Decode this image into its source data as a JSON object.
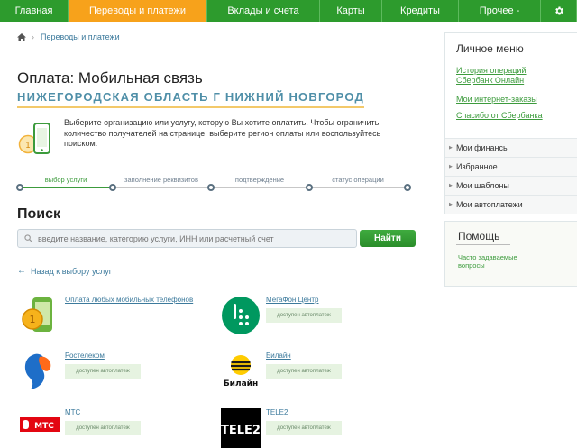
{
  "nav": {
    "items": [
      {
        "label": "Главная",
        "width": 76
      },
      {
        "label": "Переводы и платежи",
        "width": 154,
        "active": true
      },
      {
        "label": "Вклады и счета",
        "width": 125
      },
      {
        "label": "Карты",
        "width": 69
      },
      {
        "label": "Кредиты",
        "width": 85
      },
      {
        "label": "Прочее -",
        "width": 91
      }
    ],
    "settings_icon": "gear-icon"
  },
  "breadcrumb": {
    "home_icon": "home-icon",
    "current": "Переводы и платежи"
  },
  "page": {
    "title": "Оплата: Мобильная связь",
    "region": "НИЖЕГОРОДСКАЯ ОБЛАСТЬ Г НИЖНИЙ НОВГОРОД",
    "hint": "Выберите организацию или услугу, которую Вы хотите оплатить. Чтобы ограничить количество получателей на странице, выберите регион оплаты или воспользуйтесь поиском."
  },
  "steps": {
    "labels": [
      "выбор услуги",
      "заполнение реквизитов",
      "подтверждение",
      "статус операции"
    ],
    "current": 0
  },
  "search": {
    "title": "Поиск",
    "placeholder": "введите название, категорию услуги, ИНН или расчетный счет",
    "button": "Найти"
  },
  "back_link": "Назад к выбору услуг",
  "providers": [
    {
      "name": "Оплата любых мобильных телефонов",
      "auto": ""
    },
    {
      "name": "МегаФон Центр",
      "auto": "доступен автоплатеж"
    },
    {
      "name": "Ростелеком",
      "auto": "доступен автоплатеж"
    },
    {
      "name": "Билайн",
      "auto": "доступен автоплатеж"
    },
    {
      "name": "МТС",
      "auto": "доступен автоплатеж"
    },
    {
      "name": "TELE2",
      "auto": "доступен автоплатеж"
    }
  ],
  "logos": {
    "beeline_text": "Билайн",
    "mts_text": "МТС",
    "tele2_text": "TELE2"
  },
  "sidebar": {
    "title": "Личное меню",
    "links": [
      "История операций Сбербанк Онлайн",
      "Мои интернет-заказы",
      "Спасибо от Сбербанка"
    ],
    "groups": [
      "Мои финансы",
      "Избранное",
      "Мои шаблоны",
      "Мои автоплатежи"
    ]
  },
  "help": {
    "title": "Помощь",
    "faq": "Часто задаваемые вопросы"
  },
  "colors": {
    "nav_green": "#2d9b2d",
    "nav_active": "#f7a21b",
    "link_blue": "#3c7a9c",
    "sber_green": "#3c9b3c"
  }
}
